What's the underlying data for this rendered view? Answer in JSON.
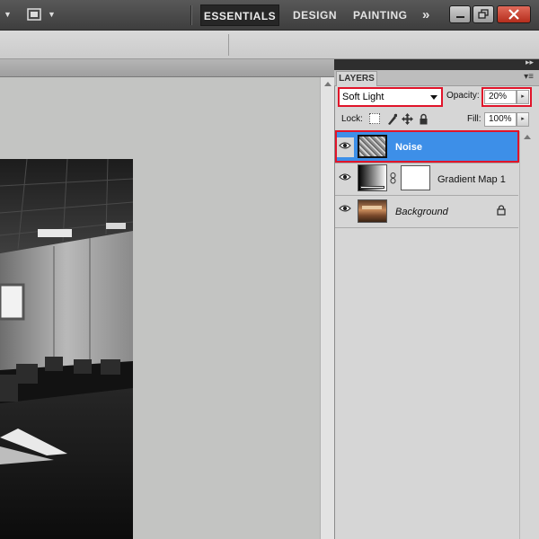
{
  "workspace": {
    "tabs": [
      "ESSENTIALS",
      "DESIGN",
      "PAINTING"
    ],
    "active": "ESSENTIALS",
    "more": "»"
  },
  "layers_panel": {
    "tab_label": "LAYERS",
    "blend_mode": "Soft Light",
    "opacity_label": "Opacity:",
    "opacity_value": "20%",
    "lock_label": "Lock:",
    "fill_label": "Fill:",
    "fill_value": "100%",
    "layers": [
      {
        "name": "Noise",
        "selected": true
      },
      {
        "name": "Gradient Map 1",
        "selected": false
      },
      {
        "name": "Background",
        "selected": false,
        "locked": true
      }
    ]
  },
  "colors": {
    "selected_layer": "#3d8fe8",
    "highlight": "#e0142a",
    "canvas_bg": "#c3c4c2"
  }
}
